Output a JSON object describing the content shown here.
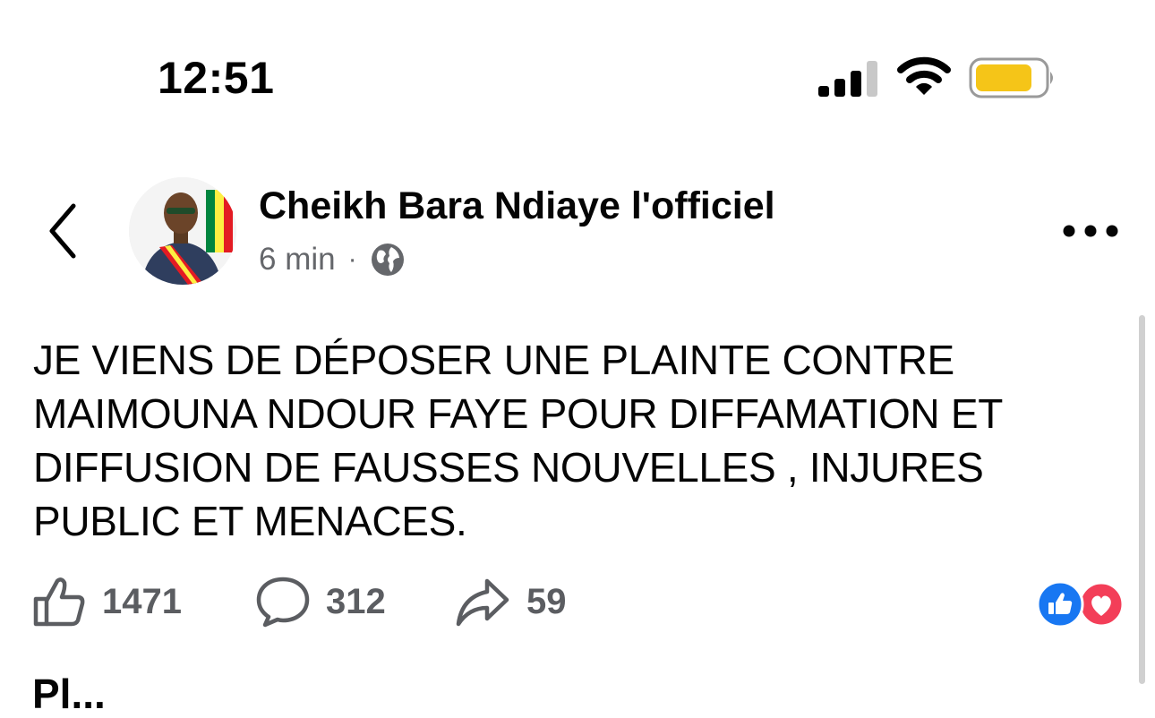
{
  "status_bar": {
    "time": "12:51",
    "signal_icon": "cellular-signal-icon",
    "wifi_icon": "wifi-icon",
    "battery_icon": "battery-icon",
    "battery_color": "#F5C518"
  },
  "post": {
    "author": "Cheikh Bara Ndiaye l'officiel",
    "time_ago": "6 min",
    "separator": "·",
    "audience_icon": "globe-icon",
    "text_lines": [
      "JE VIENS DE DÉPOSER UNE PLAINTE CONTRE",
      "MAIMOUNA NDOUR FAYE POUR DIFFAMATION ET",
      "DIFFUSION DE FAUSSES NOUVELLES , INJURES",
      "PUBLIC ET MENACES."
    ],
    "actions": {
      "likes": "1471",
      "comments": "312",
      "shares": "59"
    },
    "reactions": [
      "like-reaction-icon",
      "love-reaction-icon"
    ]
  },
  "colors": {
    "like_blue": "#1877F2",
    "love_red": "#F33E58",
    "secondary_text": "#65676B"
  },
  "next_section": {
    "title": "Pl..."
  }
}
